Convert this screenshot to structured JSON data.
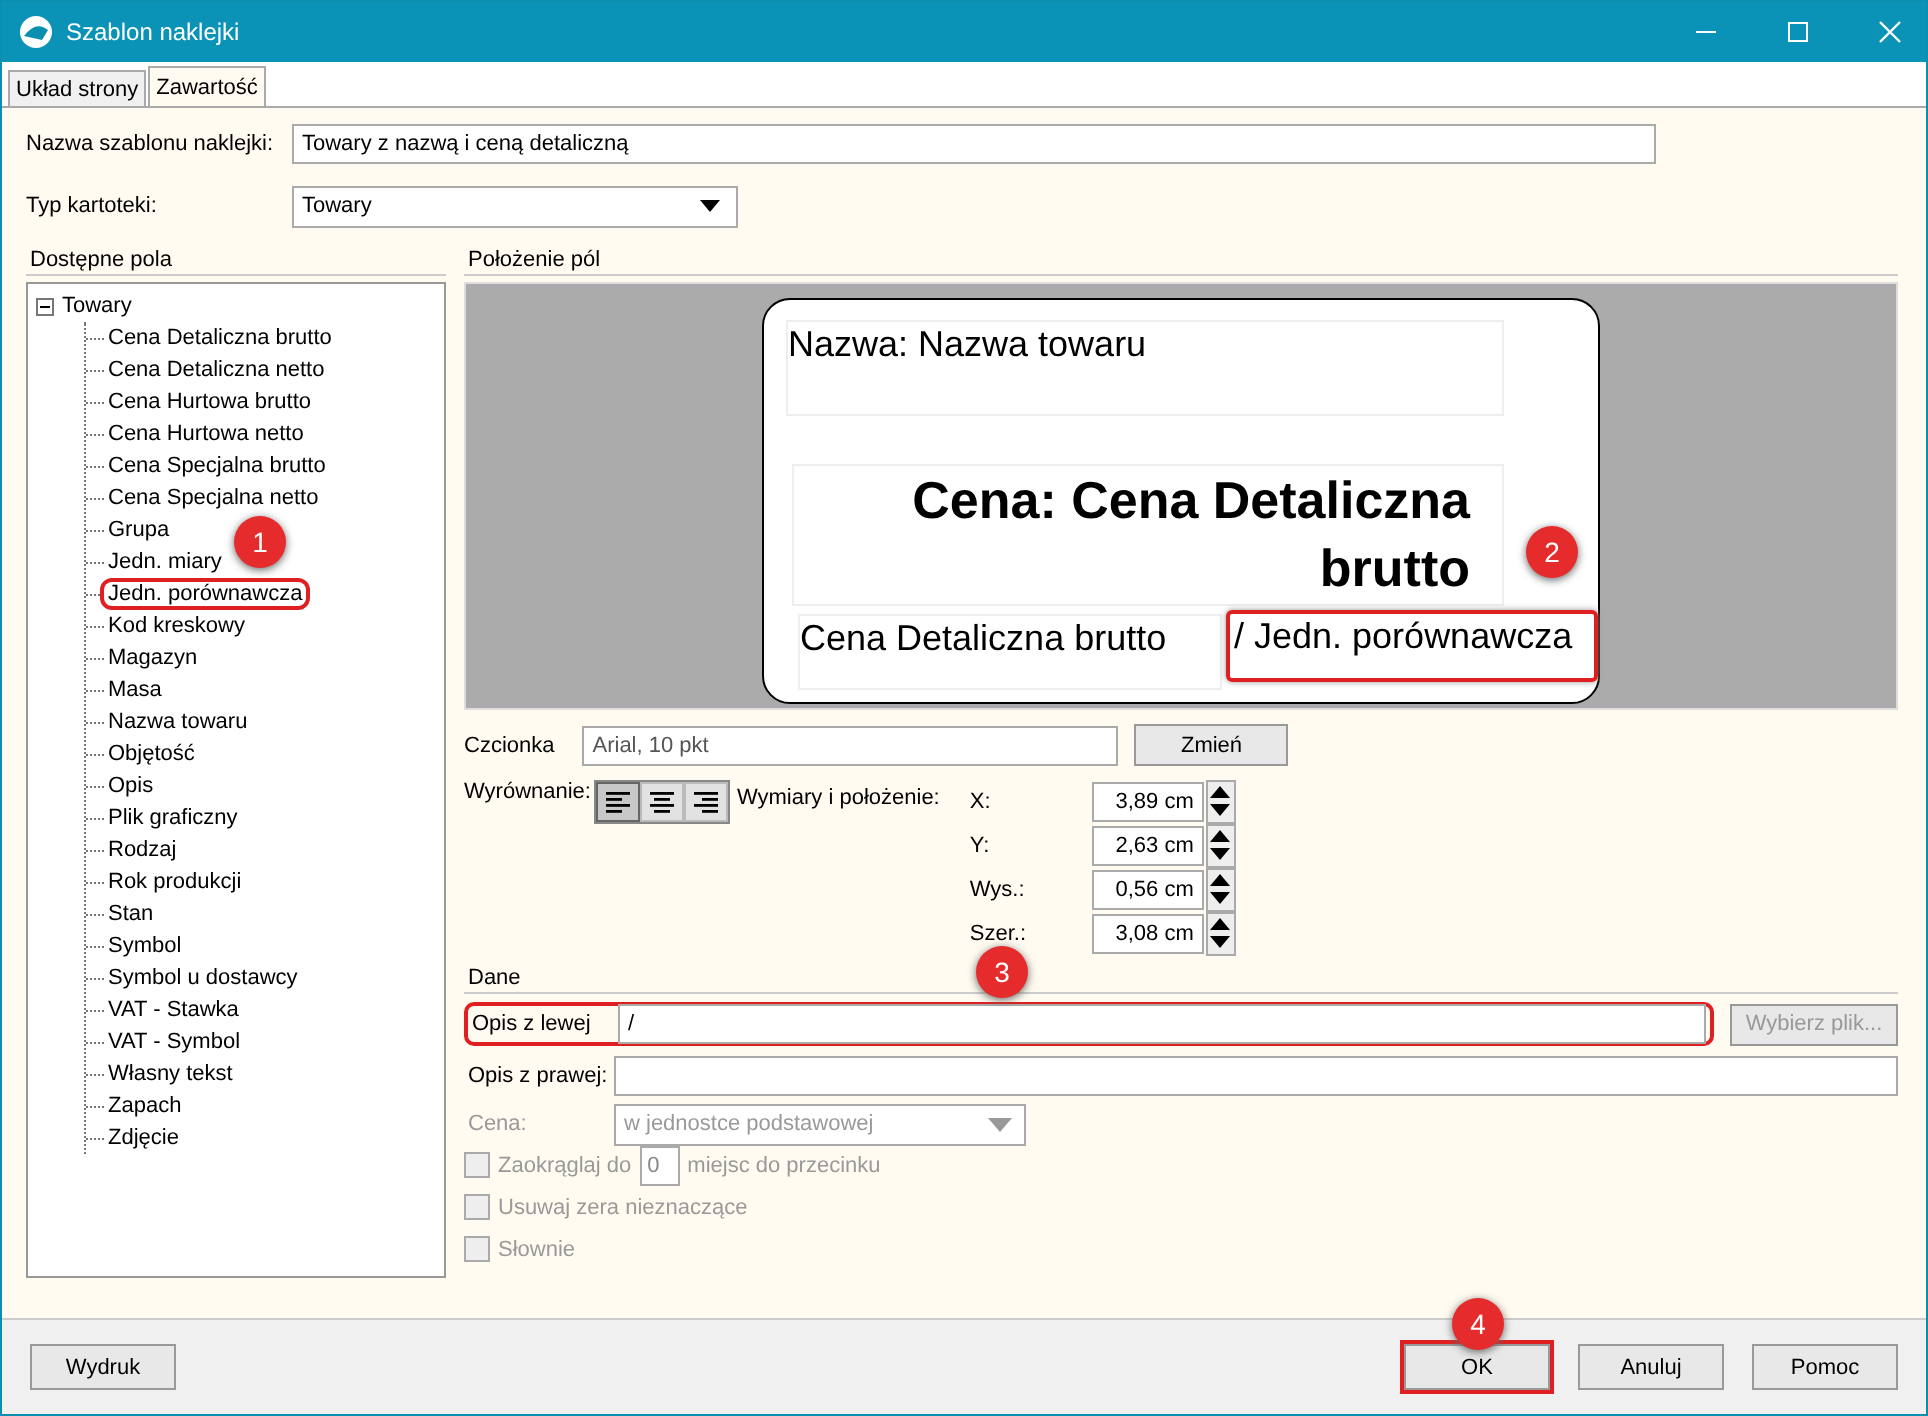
{
  "window": {
    "title": "Szablon naklejki"
  },
  "tabs": [
    {
      "label": "Układ strony",
      "selected": false
    },
    {
      "label": "Zawartość",
      "selected": true
    }
  ],
  "template_name": {
    "label": "Nazwa szablonu naklejki:",
    "value": "Towary z nazwą i ceną detaliczną"
  },
  "record_type": {
    "label": "Typ kartoteki:",
    "value": "Towary"
  },
  "fields_panel": {
    "title": "Dostępne pola",
    "tree": [
      {
        "label": "Towary",
        "expanded": true,
        "children": [
          {
            "label": "Cena Detaliczna brutto",
            "highlighted": false
          },
          {
            "label": "Cena Detaliczna netto",
            "highlighted": false
          },
          {
            "label": "Cena Hurtowa brutto",
            "highlighted": false
          },
          {
            "label": "Cena Hurtowa netto",
            "highlighted": false
          },
          {
            "label": "Cena Specjalna brutto",
            "highlighted": false
          },
          {
            "label": "Cena Specjalna netto",
            "highlighted": false
          },
          {
            "label": "Grupa",
            "highlighted": false
          },
          {
            "label": "Jedn. miary",
            "highlighted": false
          },
          {
            "label": "Jedn. porównawcza",
            "highlighted": true
          },
          {
            "label": "Kod kreskowy",
            "highlighted": false
          },
          {
            "label": "Magazyn",
            "highlighted": false
          },
          {
            "label": "Masa",
            "highlighted": false
          },
          {
            "label": "Nazwa towaru",
            "highlighted": false
          },
          {
            "label": "Objętość",
            "highlighted": false
          },
          {
            "label": "Opis",
            "highlighted": false
          },
          {
            "label": "Plik graficzny",
            "highlighted": false
          },
          {
            "label": "Rodzaj",
            "highlighted": false
          },
          {
            "label": "Rok produkcji",
            "highlighted": false
          },
          {
            "label": "Stan",
            "highlighted": false
          },
          {
            "label": "Symbol",
            "highlighted": false
          },
          {
            "label": "Symbol u dostawcy",
            "highlighted": false
          },
          {
            "label": "VAT - Stawka",
            "highlighted": false
          },
          {
            "label": "VAT - Symbol",
            "highlighted": false
          },
          {
            "label": "Własny tekst",
            "highlighted": false
          },
          {
            "label": "Zapach",
            "highlighted": false
          },
          {
            "label": "Zdjęcie",
            "highlighted": false
          }
        ]
      }
    ]
  },
  "layout_panel": {
    "title": "Położenie pól",
    "label_fields": [
      {
        "text": "Nazwa:  Nazwa towaru",
        "kind": "plain",
        "selected": false
      },
      {
        "text": "Cena:  Cena Detaliczna brutto",
        "kind": "bold",
        "selected": false
      },
      {
        "text": "Cena Detaliczna brutto",
        "kind": "plain",
        "selected": false
      },
      {
        "text": "/ Jedn. porównawcza",
        "kind": "plain",
        "selected": true
      }
    ]
  },
  "font": {
    "label": "Czcionka",
    "value": "Arial, 10 pkt",
    "button": "Zmień"
  },
  "alignment": {
    "label": "Wyrównanie:",
    "options": [
      {
        "kind": "left",
        "selected": true
      },
      {
        "kind": "center",
        "selected": false
      },
      {
        "kind": "right",
        "selected": false
      }
    ]
  },
  "dimensions": {
    "label": "Wymiary i położenie:",
    "items": [
      {
        "label": "X:",
        "value": "3,89 cm"
      },
      {
        "label": "Y:",
        "value": "2,63 cm"
      },
      {
        "label": "Wys.:",
        "value": "0,56 cm"
      },
      {
        "label": "Szer.:",
        "value": "3,08 cm"
      }
    ]
  },
  "data_section": {
    "title": "Dane",
    "left_desc": {
      "label": "Opis z lewej",
      "value": "/",
      "highlighted": true,
      "button": "Wybierz plik...",
      "button_disabled": true
    },
    "right_desc": {
      "label": "Opis z prawej:"
    },
    "price": {
      "label": "Cena:",
      "value": "w jednostce podstawowej",
      "disabled": true
    },
    "options": [
      {
        "label": "Zaokrąglaj do",
        "field": "0",
        "suffix": "miejsc do przecinku",
        "checked": false,
        "disabled": true
      },
      {
        "label": "Usuwaj zera nieznaczące",
        "checked": false,
        "disabled": true
      },
      {
        "label": "Słownie",
        "checked": false,
        "disabled": true
      }
    ]
  },
  "footer": {
    "left_button": "Wydruk",
    "buttons": [
      {
        "label": "OK",
        "highlighted": true
      },
      {
        "label": "Anuluj",
        "highlighted": false
      },
      {
        "label": "Pomoc",
        "highlighted": false
      }
    ]
  },
  "callouts": [
    "1",
    "2",
    "3",
    "4"
  ]
}
